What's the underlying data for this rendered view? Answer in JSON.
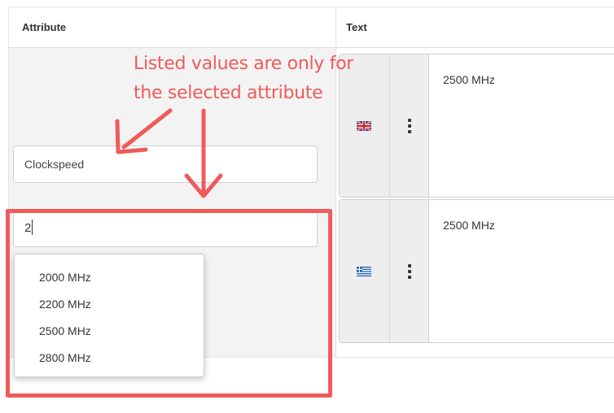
{
  "table": {
    "headers": {
      "attribute": "Attribute",
      "text": "Text"
    }
  },
  "attribute_editor": {
    "attribute_value": "Clockspeed",
    "value_input_text": "2",
    "suggestions": [
      "2000 MHz",
      "2200 MHz",
      "2500 MHz",
      "2800 MHz"
    ]
  },
  "translations": [
    {
      "flag": "uk-flag-icon",
      "text": "2500 MHz"
    },
    {
      "flag": "greece-flag-icon",
      "text": "2500 MHz"
    }
  ],
  "annotation": {
    "line1": "Listed values are only for",
    "line2": "the selected attribute",
    "color": "#f05a5a"
  }
}
